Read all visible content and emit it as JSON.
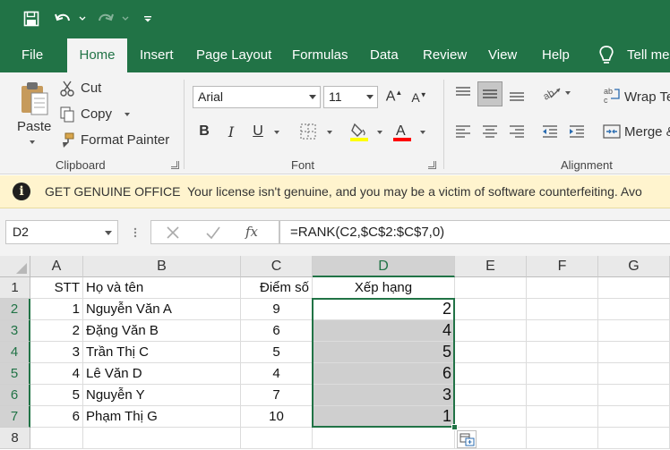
{
  "quick_access": {
    "save_icon": "save-icon",
    "undo_icon": "undo-icon",
    "redo_icon": "redo-icon",
    "customize_icon": "customize-qat-icon"
  },
  "tabs": [
    "File",
    "Home",
    "Insert",
    "Page Layout",
    "Formulas",
    "Data",
    "Review",
    "View",
    "Help"
  ],
  "active_tab": "Home",
  "tell_me": "Tell me",
  "clipboard": {
    "paste": "Paste",
    "cut": "Cut",
    "copy": "Copy",
    "format_painter": "Format Painter",
    "label": "Clipboard"
  },
  "font": {
    "name": "Arial",
    "size": "11",
    "bold": "B",
    "italic": "I",
    "underline": "U",
    "label": "Font",
    "fill_color": "#ffff00",
    "font_color": "#ff0000"
  },
  "alignment": {
    "wrap_text": "Wrap Te",
    "merge": "Merge &",
    "label": "Alignment"
  },
  "message_bar": {
    "title": "GET GENUINE OFFICE",
    "body": "Your license isn't genuine, and you may be a victim of software counterfeiting. Avo"
  },
  "formula_bar": {
    "name_box": "D2",
    "formula": "=RANK(C2,$C$2:$C$7,0)"
  },
  "sheet": {
    "columns": [
      "A",
      "B",
      "C",
      "D",
      "E",
      "F",
      "G"
    ],
    "rows": [
      "1",
      "2",
      "3",
      "4",
      "5",
      "6",
      "7",
      "8"
    ],
    "header_row": {
      "a": "STT",
      "b": "Họ và tên",
      "c": "Điểm số",
      "d": "Xếp hạng"
    },
    "data": [
      {
        "a": "1",
        "b": "Nguyễn Văn A",
        "c": "9",
        "d": "2"
      },
      {
        "a": "2",
        "b": "Đặng Văn B",
        "c": "6",
        "d": "4"
      },
      {
        "a": "3",
        "b": "Trần Thị C",
        "c": "5",
        "d": "5"
      },
      {
        "a": "4",
        "b": "Lê Văn D",
        "c": "4",
        "d": "6"
      },
      {
        "a": "5",
        "b": "Nguyễn Y",
        "c": "7",
        "d": "3"
      },
      {
        "a": "6",
        "b": "Phạm Thị G",
        "c": "10",
        "d": "1"
      }
    ],
    "selected_range": "D2:D7",
    "accent": "#217346"
  }
}
